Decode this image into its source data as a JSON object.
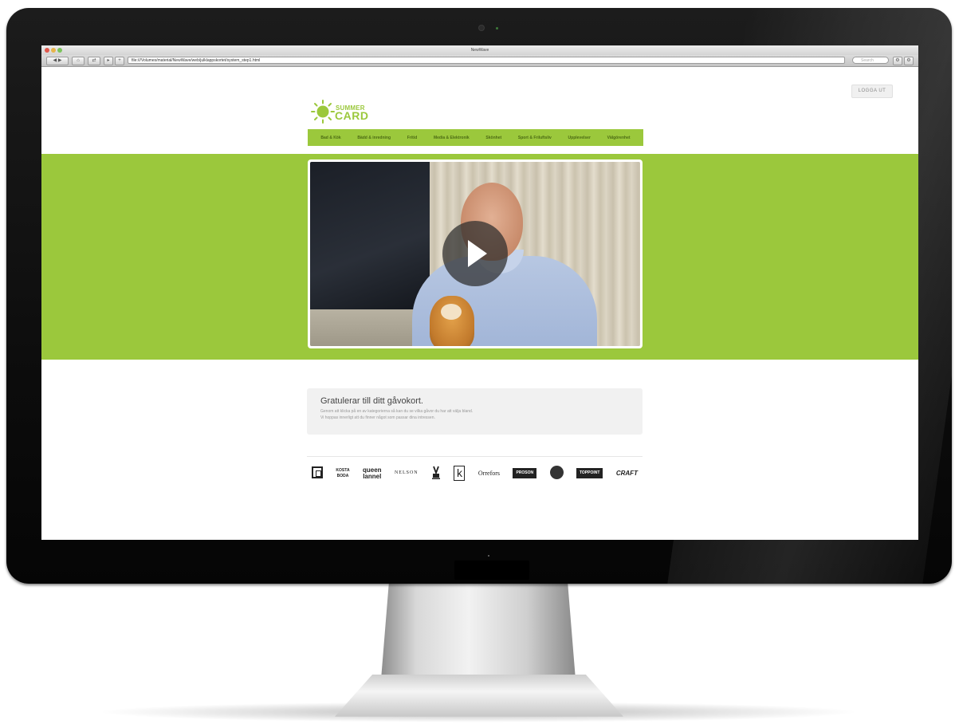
{
  "browser": {
    "window_title": "NewWave",
    "url": "file:///Volumes/material/NewWave/web/julklappskortet/system_step1.html",
    "search_placeholder": "Search"
  },
  "header": {
    "logout_label": "LOGGA UT",
    "logo_line1": "SUMMER",
    "logo_line2": "CARD"
  },
  "nav": {
    "items": [
      {
        "label": "Bad & Kök"
      },
      {
        "label": "Bädd & inredning"
      },
      {
        "label": "Fritid"
      },
      {
        "label": "Media & Elektronik"
      },
      {
        "label": "Skönhet"
      },
      {
        "label": "Sport & Friluftsliv"
      },
      {
        "label": "Upplevelser"
      },
      {
        "label": "Välgörenhet"
      }
    ]
  },
  "welcome": {
    "title": "Gratulerar till ditt gåvokort.",
    "line1": "Genom att klicka på en av kategorierna så kan du se vilka gåvor du har att välja bland.",
    "line2": "Vi hoppas innerligt att du finner något som passar dina intressen."
  },
  "brands": {
    "kosta_line1": "KOSTA",
    "kosta_line2": "BODA",
    "queen_line1": "queen",
    "queen_line2": "lannel",
    "nelson": "NELSON",
    "orrefors": "Orrefors",
    "proson": "PROSON",
    "topoint": "TOPPOINT",
    "craft": "CRAFT"
  },
  "colors": {
    "brand_green": "#9bc83c",
    "nav_text": "#4c6b14"
  }
}
